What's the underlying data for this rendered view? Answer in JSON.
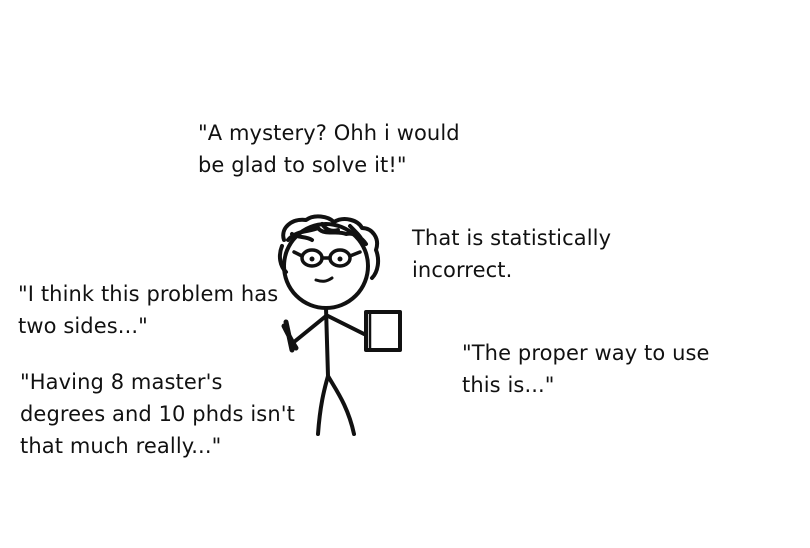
{
  "quotes": {
    "mystery": "\"A mystery? Ohh i would\nbe glad to solve it!\"",
    "statistics": "That is statistically\nincorrect.",
    "two_sides": "\"I think this problem has\ntwo sides...\"",
    "proper_way": "\"The proper way to use\nthis is...\"",
    "degrees": "\"Having 8 master's\ndegrees and 10 phds isn't\nthat much really...\""
  },
  "colors": {
    "background": "#ffffff",
    "ink": "#111111"
  },
  "figure": {
    "icon": "stick-figure-with-glasses-holding-book"
  }
}
